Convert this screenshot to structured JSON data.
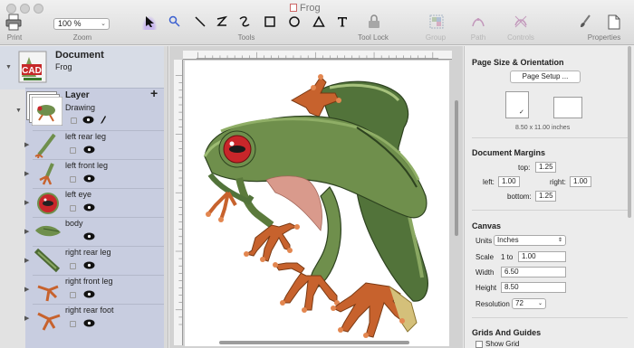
{
  "window": {
    "title": "Frog"
  },
  "toolbar": {
    "print_label": "Print",
    "zoom_label": "Zoom",
    "zoom_value": "100 %",
    "tools_label": "Tools",
    "tool_lock_label": "Tool Lock",
    "group_label": "Group",
    "path_label": "Path",
    "controls_label": "Controls",
    "properties_label": "Properties",
    "tools": [
      "arrow-select-icon",
      "direct-select-icon",
      "line-tool-icon",
      "polyline-tool-icon",
      "curve-tool-icon",
      "rectangle-tool-icon",
      "ellipse-tool-icon",
      "triangle-tool-icon",
      "text-tool-icon"
    ]
  },
  "layers": {
    "document_title": "Document",
    "document_name": "Frog",
    "layer_title": "Layer",
    "layer_name": "Drawing",
    "items": [
      {
        "label": "left rear leg"
      },
      {
        "label": "left front leg"
      },
      {
        "label": "left eye"
      },
      {
        "label": "body"
      },
      {
        "label": "right rear leg"
      },
      {
        "label": "right front leg"
      },
      {
        "label": "right rear foot"
      }
    ]
  },
  "inspector": {
    "page_section": "Page Size & Orientation",
    "page_setup_button": "Page Setup ...",
    "page_size_text": "8.50 x 11.00 inches",
    "margins_section": "Document Margins",
    "top_label": "top:",
    "top_value": "1.25",
    "left_label": "left:",
    "left_value": "1.00",
    "right_label": "right:",
    "right_value": "1.00",
    "bottom_label": "bottom:",
    "bottom_value": "1.25",
    "canvas_section": "Canvas",
    "units_label": "Units",
    "units_value": "Inches",
    "scale_label": "Scale",
    "scale_one_to": "1 to",
    "scale_value": "1.00",
    "width_label": "Width",
    "width_value": "6.50",
    "height_label": "Height",
    "height_value": "8.50",
    "resolution_label": "Resolution",
    "resolution_value": "72",
    "grids_section": "Grids And Guides",
    "show_grid_label": "Show Grid"
  },
  "colors": {
    "frog_green": "#6f8f4c",
    "frog_dark": "#3d5a2a",
    "eye_red": "#c8262a",
    "foot_orange": "#c7622d",
    "layer_panel": "#c8cde0"
  }
}
